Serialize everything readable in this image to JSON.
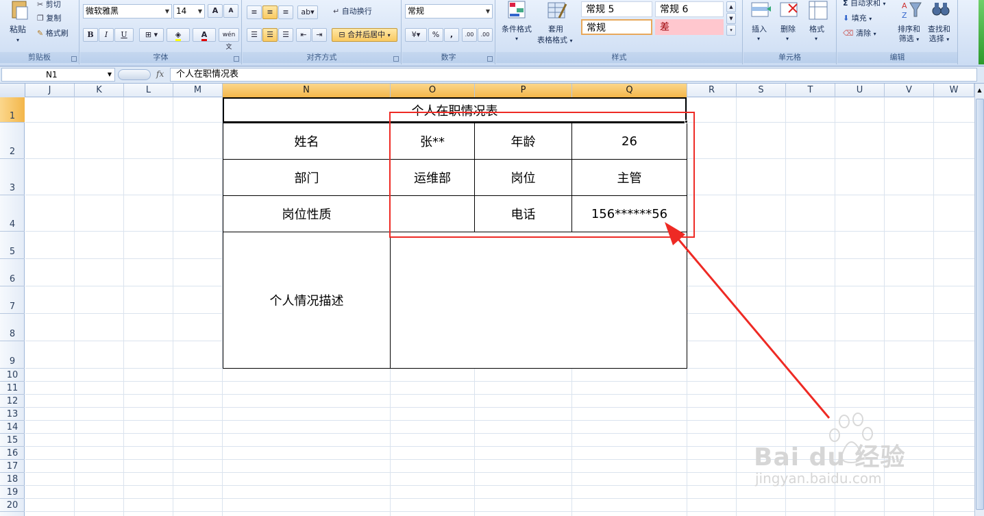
{
  "ribbon": {
    "clipboard": {
      "label": "剪贴板",
      "paste": "粘贴",
      "cut": "剪切",
      "copy": "复制",
      "format_painter": "格式刷"
    },
    "font": {
      "label": "字体",
      "font_name": "微软雅黑",
      "font_size": "14",
      "grow": "A",
      "shrink": "A",
      "bold": "B",
      "italic": "I",
      "underline": "U",
      "wen": "wén 文"
    },
    "alignment": {
      "label": "对齐方式",
      "wrap": "自动换行",
      "merge_center": "合并后居中"
    },
    "number": {
      "label": "数字",
      "format": "常规",
      "percent": "%",
      "comma": ",",
      "inc_dec": ".00",
      "dec_dec": ".00"
    },
    "styles": {
      "label": "样式",
      "conditional": "条件格式",
      "table_format_1": "套用",
      "table_format_2": "表格格式",
      "style_normal5": "常规 5",
      "style_normal6": "常规 6",
      "style_normal": "常规",
      "style_bad": "差"
    },
    "cells": {
      "label": "单元格",
      "insert": "插入",
      "delete": "删除",
      "format": "格式"
    },
    "editing": {
      "label": "编辑",
      "autosum": "自动求和",
      "fill": "填充",
      "clear": "清除",
      "sort_1": "排序和",
      "sort_2": "筛选",
      "find_1": "查找和",
      "find_2": "选择"
    }
  },
  "formula_bar": {
    "name_box": "N1",
    "fx": "fx",
    "content": "个人在职情况表"
  },
  "columns": [
    "J",
    "K",
    "L",
    "M",
    "N",
    "O",
    "P",
    "Q",
    "R",
    "S",
    "T",
    "U",
    "V",
    "W"
  ],
  "rows": [
    "1",
    "2",
    "3",
    "4",
    "5",
    "6",
    "7",
    "8",
    "9",
    "10",
    "11",
    "12",
    "13",
    "14",
    "15",
    "16",
    "17",
    "18",
    "19",
    "20"
  ],
  "table": {
    "title": "个人在职情况表",
    "name_label": "姓名",
    "name_value": "张**",
    "age_label": "年龄",
    "age_value": "26",
    "dept_label": "部门",
    "dept_value": "运维部",
    "post_label": "岗位",
    "post_value": "主管",
    "nature_label": "岗位性质",
    "nature_value": "",
    "phone_label": "电话",
    "phone_value": "156******56",
    "desc_label": "个人情况描述",
    "desc_value": ""
  },
  "watermark": {
    "brand": "Bai du 经验",
    "url": "jingyan.baidu.com"
  },
  "colors": {
    "annotation": "#ee2a24",
    "selected_header": "#f3b64a",
    "gridline": "#dae3ee",
    "bad_style_bg": "#ffc7ce"
  }
}
